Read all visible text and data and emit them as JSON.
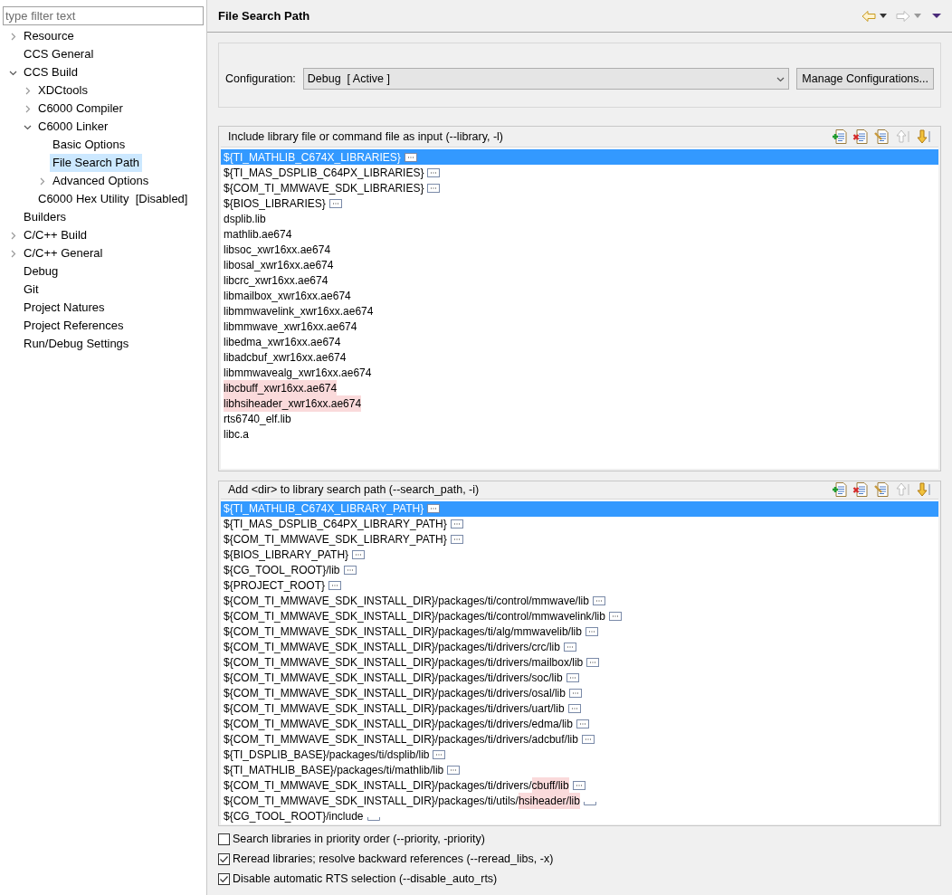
{
  "sidebar": {
    "filter": {
      "placeholder": "type filter text"
    },
    "items": [
      {
        "label": "Resource",
        "expanded": false,
        "selected": false
      },
      {
        "label": "CCS General",
        "selected": false
      },
      {
        "label": "CCS Build",
        "expanded": true,
        "selected": false,
        "children": [
          {
            "label": "XDCtools",
            "expanded": false,
            "selected": false
          },
          {
            "label": "C6000 Compiler",
            "expanded": false,
            "selected": false
          },
          {
            "label": "C6000 Linker",
            "expanded": true,
            "selected": false,
            "children": [
              {
                "label": "Basic Options",
                "selected": false
              },
              {
                "label": "File Search Path",
                "selected": true
              },
              {
                "label": "Advanced Options",
                "expanded": false,
                "selected": false
              }
            ]
          },
          {
            "label": "C6000 Hex Utility  [Disabled]",
            "selected": false
          }
        ]
      },
      {
        "label": "Builders",
        "selected": false
      },
      {
        "label": "C/C++ Build",
        "expanded": false,
        "selected": false
      },
      {
        "label": "C/C++ General",
        "expanded": false,
        "selected": false
      },
      {
        "label": "Debug",
        "selected": false
      },
      {
        "label": "Git",
        "selected": false
      },
      {
        "label": "Project Natures",
        "selected": false
      },
      {
        "label": "Project References",
        "selected": false
      },
      {
        "label": "Run/Debug Settings",
        "selected": false
      }
    ]
  },
  "page": {
    "title": "File Search Path",
    "configuration": {
      "label": "Configuration:",
      "value": "Debug  [ Active ]",
      "button": "Manage Configurations..."
    },
    "lists": [
      {
        "title": "Include library file or command file as input (--library, -l)",
        "items": [
          {
            "text": "${TI_MATHLIB_C674X_LIBRARIES}",
            "kind": "dots",
            "selected": true
          },
          {
            "text": "${TI_MAS_DSPLIB_C64PX_LIBRARIES}",
            "kind": "dots",
            "selected": false
          },
          {
            "text": "${COM_TI_MMWAVE_SDK_LIBRARIES}",
            "kind": "dots",
            "selected": false
          },
          {
            "text": "${BIOS_LIBRARIES}",
            "kind": "dots",
            "selected": false
          },
          {
            "text": "dsplib.lib",
            "selected": false
          },
          {
            "text": "mathlib.ae674",
            "selected": false
          },
          {
            "text": "libsoc_xwr16xx.ae674",
            "selected": false
          },
          {
            "text": "libosal_xwr16xx.ae674",
            "selected": false
          },
          {
            "text": "libcrc_xwr16xx.ae674",
            "selected": false
          },
          {
            "text": "libmailbox_xwr16xx.ae674",
            "selected": false
          },
          {
            "text": "libmmwavelink_xwr16xx.ae674",
            "selected": false
          },
          {
            "text": "libmmwave_xwr16xx.ae674",
            "selected": false
          },
          {
            "text": "libedma_xwr16xx.ae674",
            "selected": false
          },
          {
            "text": "libadcbuf_xwr16xx.ae674",
            "selected": false
          },
          {
            "text": "libmmwavealg_xwr16xx.ae674",
            "selected": false
          },
          {
            "highlight": "libcbuff_xwr16xx.ae674",
            "selected": false
          },
          {
            "highlight": "libhsiheader_xwr16xx.ae674",
            "selected": false
          },
          {
            "text": "rts6740_elf.lib",
            "selected": false
          },
          {
            "text": "libc.a",
            "selected": false
          }
        ]
      },
      {
        "title": "Add <dir> to library search path (--search_path, -i)",
        "items": [
          {
            "text": "${TI_MATHLIB_C674X_LIBRARY_PATH}",
            "kind": "dots",
            "selected": true
          },
          {
            "text": "${TI_MAS_DSPLIB_C64PX_LIBRARY_PATH}",
            "kind": "dots",
            "selected": false
          },
          {
            "text": "${COM_TI_MMWAVE_SDK_LIBRARY_PATH}",
            "kind": "dots",
            "selected": false
          },
          {
            "text": "${BIOS_LIBRARY_PATH}",
            "kind": "dots",
            "selected": false
          },
          {
            "text": "${CG_TOOL_ROOT}/lib",
            "kind": "dots",
            "selected": false
          },
          {
            "text": "${PROJECT_ROOT}",
            "kind": "dots",
            "selected": false
          },
          {
            "text": "${COM_TI_MMWAVE_SDK_INSTALL_DIR}/packages/ti/control/mmwave/lib",
            "kind": "dots",
            "selected": false
          },
          {
            "text": "${COM_TI_MMWAVE_SDK_INSTALL_DIR}/packages/ti/control/mmwavelink/lib",
            "kind": "dots",
            "selected": false
          },
          {
            "text": "${COM_TI_MMWAVE_SDK_INSTALL_DIR}/packages/ti/alg/mmwavelib/lib",
            "kind": "dots",
            "selected": false
          },
          {
            "text": "${COM_TI_MMWAVE_SDK_INSTALL_DIR}/packages/ti/drivers/crc/lib",
            "kind": "dots",
            "selected": false
          },
          {
            "text": "${COM_TI_MMWAVE_SDK_INSTALL_DIR}/packages/ti/drivers/mailbox/lib",
            "kind": "dots",
            "selected": false
          },
          {
            "text": "${COM_TI_MMWAVE_SDK_INSTALL_DIR}/packages/ti/drivers/soc/lib",
            "kind": "dots",
            "selected": false
          },
          {
            "text": "${COM_TI_MMWAVE_SDK_INSTALL_DIR}/packages/ti/drivers/osal/lib",
            "kind": "dots",
            "selected": false
          },
          {
            "text": "${COM_TI_MMWAVE_SDK_INSTALL_DIR}/packages/ti/drivers/uart/lib",
            "kind": "dots",
            "selected": false
          },
          {
            "text": "${COM_TI_MMWAVE_SDK_INSTALL_DIR}/packages/ti/drivers/edma/lib",
            "kind": "dots",
            "selected": false
          },
          {
            "text": "${COM_TI_MMWAVE_SDK_INSTALL_DIR}/packages/ti/drivers/adcbuf/lib",
            "kind": "dots",
            "selected": false
          },
          {
            "text": "${TI_DSPLIB_BASE}/packages/ti/dsplib/lib",
            "kind": "dots",
            "selected": false
          },
          {
            "text": "${TI_MATHLIB_BASE}/packages/ti/mathlib/lib",
            "kind": "dots",
            "selected": false
          },
          {
            "text": "${COM_TI_MMWAVE_SDK_INSTALL_DIR}/packages/ti/drivers/",
            "highlight": "cbuff/lib",
            "kind": "dots",
            "selected": false
          },
          {
            "text": "${COM_TI_MMWAVE_SDK_INSTALL_DIR}/packages/ti/utils/",
            "highlight": "hsiheader/lib",
            "kind": "line",
            "selected": false
          },
          {
            "text": "${CG_TOOL_ROOT}/include",
            "kind": "line",
            "selected": false
          }
        ]
      }
    ],
    "options": [
      {
        "label": "Search libraries in priority order (--priority, -priority)",
        "checked": false
      },
      {
        "label": "Reread libraries; resolve backward references (--reread_libs, -x)",
        "checked": true
      },
      {
        "label": "Disable automatic RTS selection (--disable_auto_rts)",
        "checked": true
      }
    ]
  }
}
